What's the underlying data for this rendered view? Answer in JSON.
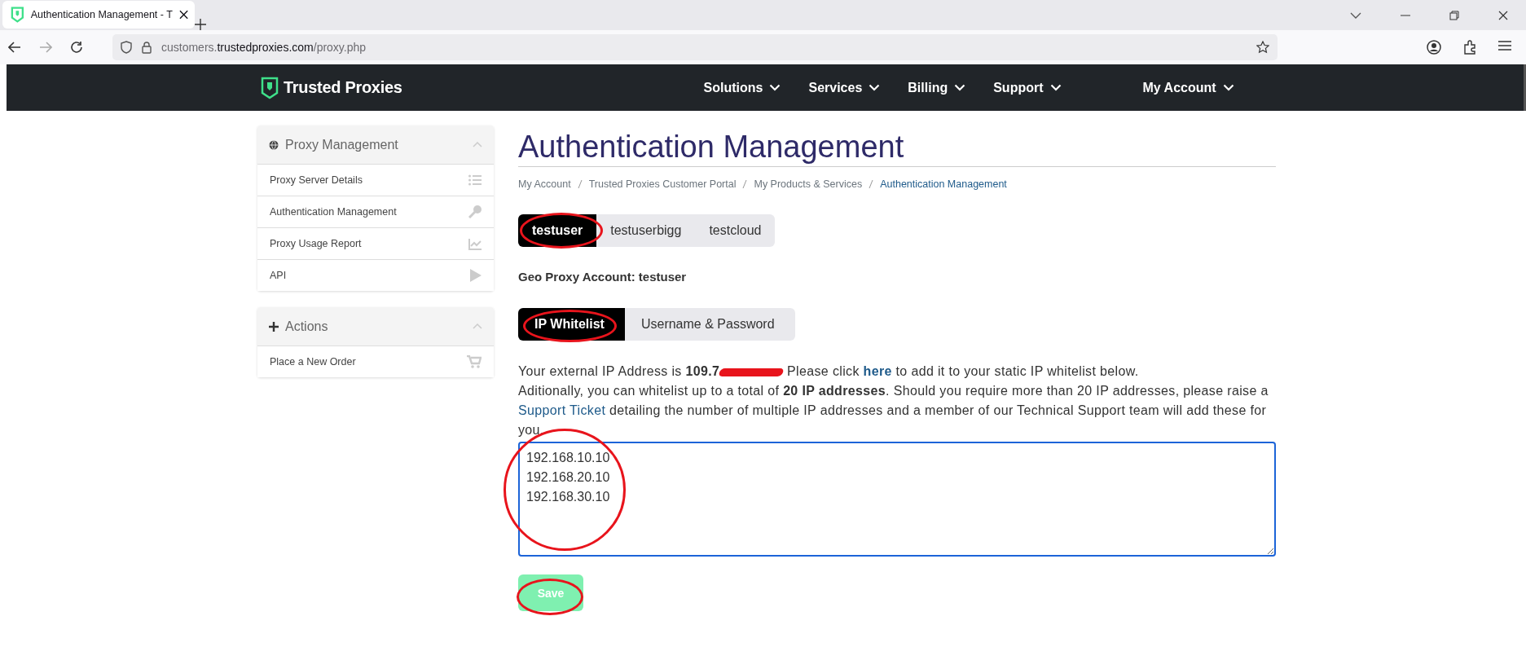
{
  "browser": {
    "tab_title": "Authentication Management - T",
    "url": {
      "subdomain": "customers.",
      "domain": "trustedproxies.com",
      "path": "/proxy.php"
    }
  },
  "navbar": {
    "brand": "Trusted Proxies",
    "menu": [
      {
        "label": "Solutions",
        "kind": "main"
      },
      {
        "label": "Services",
        "kind": "main"
      },
      {
        "label": "Billing",
        "kind": "main"
      },
      {
        "label": "Support",
        "kind": "main"
      },
      {
        "label": "My Account",
        "kind": "account"
      }
    ]
  },
  "sidebar": {
    "panels": [
      {
        "title": "Proxy Management",
        "kind": "globe",
        "items": [
          {
            "label": "Proxy Server Details",
            "kind": "list"
          },
          {
            "label": "Authentication Management",
            "kind": "key"
          },
          {
            "label": "Proxy Usage Report",
            "kind": "chart"
          },
          {
            "label": "API",
            "kind": "play"
          }
        ]
      },
      {
        "title": "Actions",
        "kind": "plus",
        "items": [
          {
            "label": "Place a New Order",
            "kind": "cart"
          }
        ]
      }
    ]
  },
  "main": {
    "title": "Authentication Management",
    "breadcrumb": [
      {
        "label": "My Account",
        "selected": false
      },
      {
        "label": "Trusted Proxies Customer Portal",
        "selected": false
      },
      {
        "label": "My Products & Services",
        "selected": false
      },
      {
        "label": "Authentication Management",
        "selected": true
      }
    ],
    "accounts": [
      {
        "label": "testuser",
        "selected": true,
        "circled": true
      },
      {
        "label": "testuserbigg",
        "selected": false,
        "circled": false
      },
      {
        "label": "testcloud",
        "selected": false,
        "circled": false
      }
    ],
    "account_heading": "Geo Proxy Account: testuser",
    "modes": [
      {
        "label": "IP Whitelist",
        "selected": true,
        "circled": true
      },
      {
        "label": "Username & Password",
        "selected": false,
        "circled": false
      }
    ],
    "intro": {
      "before": "Your external IP Address is **109.7**",
      "redacted": true,
      "middle": " Please click ",
      "link": "here",
      "after": " to add it to your static IP whitelist below."
    },
    "note": {
      "before": "Aditionally, you can whitelist up to a total of **20 IP addresses**. Should you require more than 20 IP addresses, please raise a ",
      "link": "Support Ticket",
      "after": " detailing the number of multiple IP addresses and a member of our Technical Support team will add these for you."
    },
    "whitelist": {
      "value": "192.168.10.10\n192.168.20.10\n192.168.30.10",
      "circled": true
    },
    "save": {
      "label": "Save",
      "circled": true
    }
  }
}
